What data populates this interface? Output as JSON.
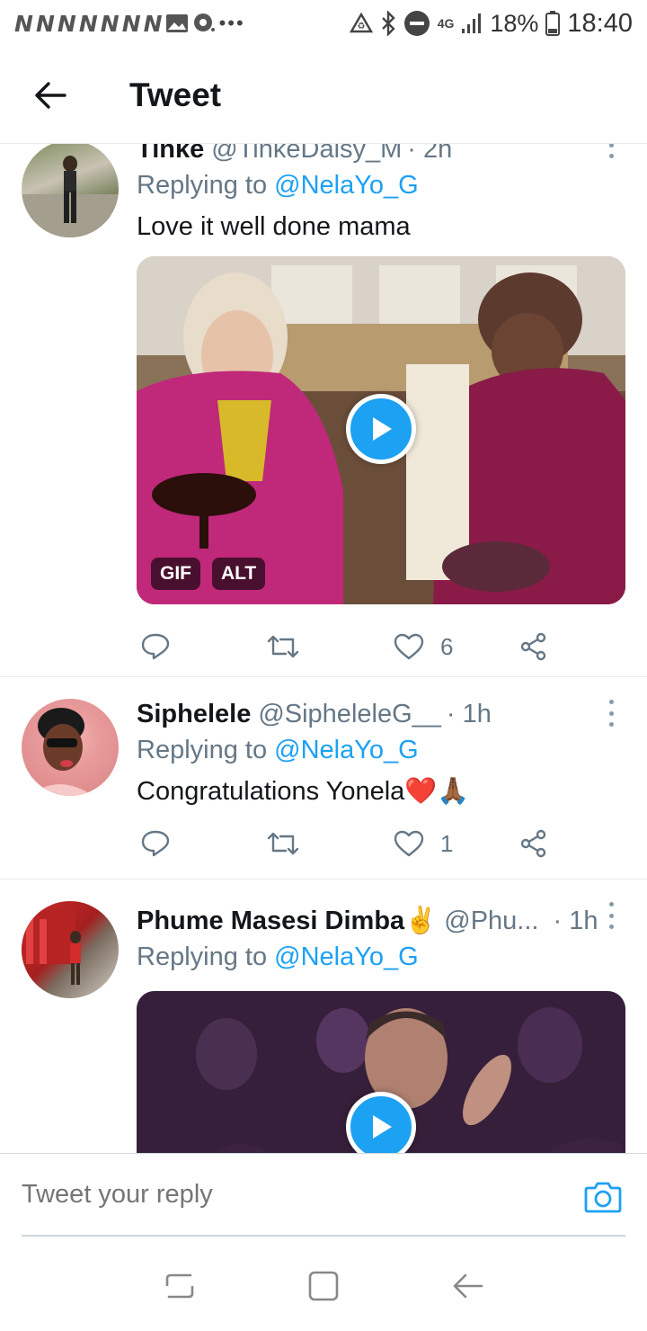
{
  "status_bar": {
    "notification_glyphs": [
      "N",
      "N",
      "N",
      "N",
      "N",
      "N",
      "N"
    ],
    "network": "4G",
    "battery": "18%",
    "time": "18:40"
  },
  "header": {
    "back_icon": "arrow-left-icon",
    "title": "Tweet"
  },
  "tweets": [
    {
      "name": "Tinke",
      "handle": "@TinkeDaisy_M",
      "time": "· 2h",
      "replying_prefix": "Replying to",
      "replying_to": "@NelaYo_G",
      "text": "Love it well done mama",
      "media": {
        "type": "gif",
        "badges": [
          "GIF",
          "ALT"
        ]
      },
      "actions": {
        "reply_count": "",
        "retweet_count": "",
        "like_count": "6"
      }
    },
    {
      "name": "Siphelele",
      "handle": "@SipheleleG__",
      "time": "· 1h",
      "replying_prefix": "Replying to",
      "replying_to": "@NelaYo_G",
      "text": "Congratulations Yonela❤️🙏🏾",
      "actions": {
        "reply_count": "",
        "retweet_count": "",
        "like_count": "1"
      }
    },
    {
      "name": "Phume Masesi Dimba✌️",
      "handle": "@Phu...",
      "time": "· 1h",
      "replying_prefix": "Replying to",
      "replying_to": "@NelaYo_G",
      "media": {
        "type": "video"
      }
    }
  ],
  "composer": {
    "placeholder": "Tweet your reply",
    "camera_icon": "camera-icon"
  },
  "nav": [
    "recents-icon",
    "home-icon",
    "back-icon"
  ],
  "colors": {
    "accent": "#1da1f2",
    "secondary_text": "#657786",
    "divider": "#e6ecf0"
  }
}
